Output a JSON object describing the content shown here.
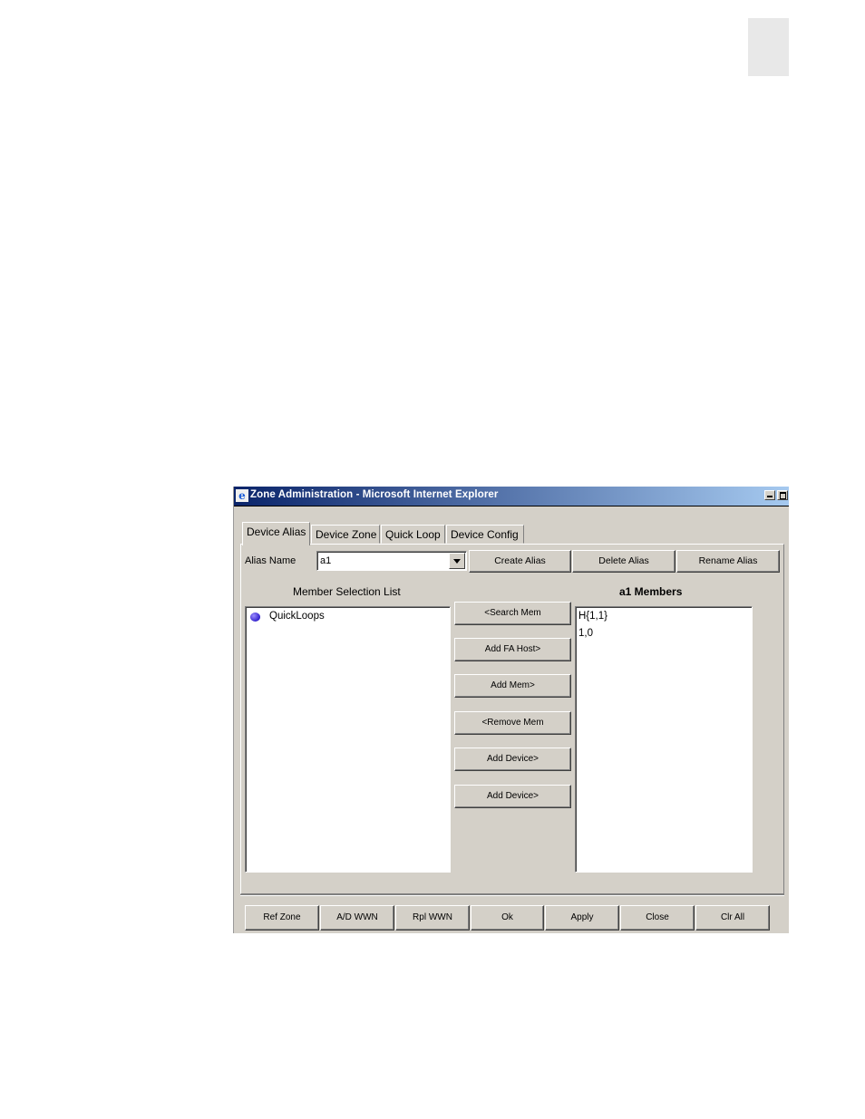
{
  "window": {
    "title": "Zone Administration - Microsoft Internet Explorer"
  },
  "tabs": [
    {
      "label": "Device Alias",
      "active": true
    },
    {
      "label": "Device Zone",
      "active": false
    },
    {
      "label": "Quick Loop",
      "active": false
    },
    {
      "label": "Device Config",
      "active": false
    }
  ],
  "alias": {
    "label": "Alias Name",
    "value": "a1",
    "buttons": {
      "create": "Create Alias",
      "delete": "Delete Alias",
      "rename": "Rename Alias"
    }
  },
  "member_selection": {
    "heading": "Member Selection List",
    "items": [
      {
        "label": "QuickLoops",
        "icon": "blue-sphere-icon"
      }
    ]
  },
  "middle_buttons": {
    "search_mem": "<Search Mem",
    "add_fa_host": "Add FA Host>",
    "add_mem": "Add Mem>",
    "remove_mem": "<Remove Mem",
    "add_device_1": "Add Device>",
    "add_device_2": "Add Device>"
  },
  "members": {
    "heading": "a1 Members",
    "items": [
      "H{1,1}",
      "1,0"
    ]
  },
  "bottom_buttons": {
    "ref_zone": "Ref Zone",
    "ad_wwn": "A/D WWN",
    "rpl_wwn": "Rpl WWN",
    "ok": "Ok",
    "apply": "Apply",
    "close": "Close",
    "clr_all": "Clr All"
  },
  "colors": {
    "titlebar_start": "#0a246a",
    "titlebar_end": "#a6caf0",
    "face": "#d4d0c8"
  }
}
